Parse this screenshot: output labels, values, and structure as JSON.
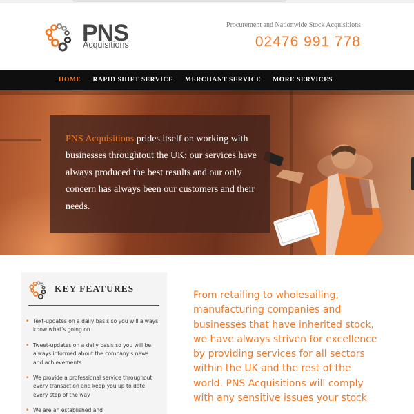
{
  "header": {
    "logo_main": "PNS",
    "logo_sub": "Acquisitions",
    "tagline": "Procurement and Nationwide Stock Acquisitions",
    "phone": "02476 991 778"
  },
  "nav": {
    "items": [
      {
        "label": "HOME",
        "active": true
      },
      {
        "label": "RAPID SHIFT SERVICE",
        "active": false
      },
      {
        "label": "MERCHANT SERVICE",
        "active": false
      },
      {
        "label": "MORE SERVICES",
        "active": false
      }
    ]
  },
  "hero": {
    "accent": "PNS Acquisitions",
    "text": " prides itself on working with businesses throughtout the UK; our services have always produced the best results and our only concern has always been our customers and their needs."
  },
  "features": {
    "title": "KEY FEATURES",
    "items": [
      "Text-updates on a daily basis so you will always know what's going on",
      "Tweet-updates on a daily basis so you will be always informed about the company's news and achievements",
      "We provide a professional service throughout every transaction and keep you up to date every step of the way",
      "We are an established and"
    ]
  },
  "main": {
    "copy": "From retailing to wholesailing, manufacturing companies and businesses that have inherited stock, we have always striven for excellence by providing services for all sectors within the UK and the rest of the world. PNS Acquisitions will comply with any sensitive issues your stock"
  },
  "colors": {
    "accent": "#f07a28",
    "nav_bg": "#0f0f0f",
    "panel_bg": "#f4f4f4"
  },
  "icons": [
    "logo-gear-icon",
    "features-gear-icon"
  ]
}
